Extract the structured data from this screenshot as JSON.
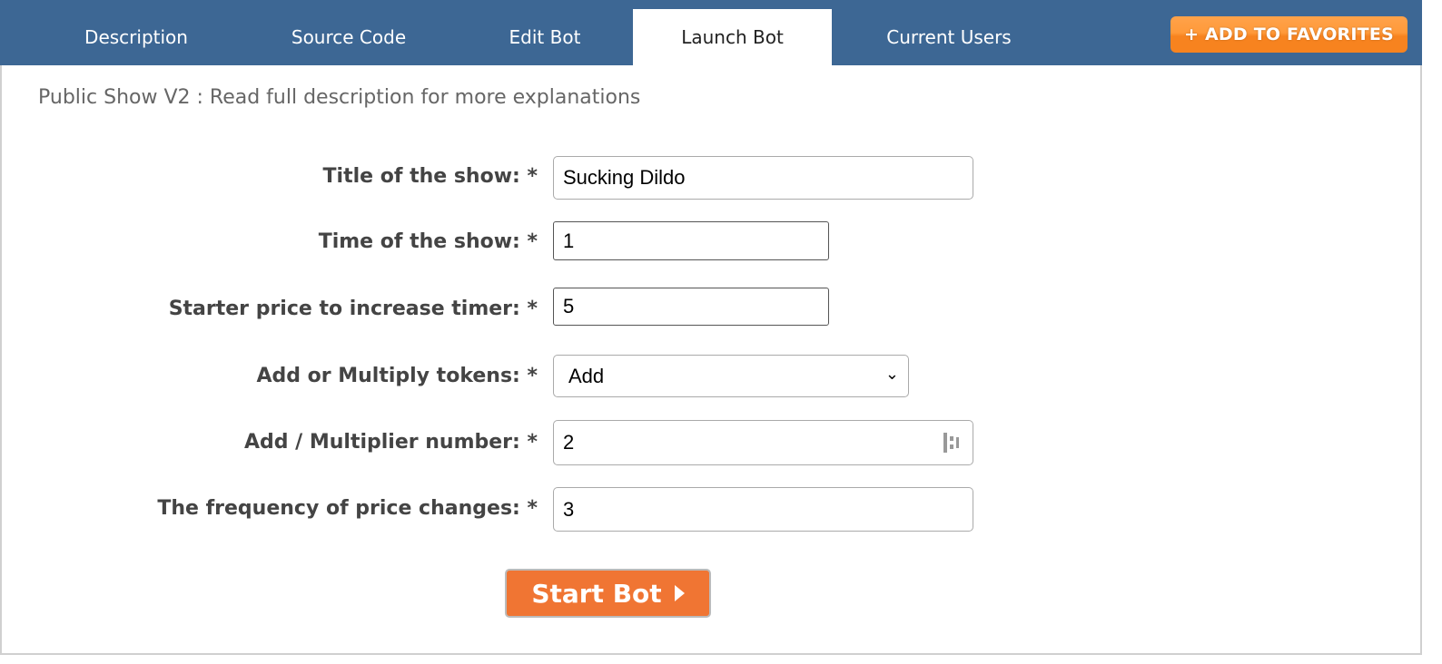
{
  "tabs": [
    {
      "label": "Description"
    },
    {
      "label": "Source Code"
    },
    {
      "label": "Edit Bot"
    },
    {
      "label": "Launch Bot",
      "active": true
    },
    {
      "label": "Current Users"
    }
  ],
  "favorites_label": "+ ADD TO FAVORITES",
  "subtitle": "Public Show V2 : Read full description for more explanations",
  "fields": [
    {
      "label": "Title of the show: *",
      "value": "Sucking Dildo"
    },
    {
      "label": "Time of the show: *",
      "value": "1"
    },
    {
      "label": "Starter price to increase timer: *",
      "value": "5"
    },
    {
      "label": "Add or Multiply tokens: *",
      "value": "Add"
    },
    {
      "label": "Add / Multiplier number: *",
      "value": "2"
    },
    {
      "label": "The frequency of price changes: *",
      "value": "3"
    }
  ],
  "start_label": "Start Bot",
  "colors": {
    "header": "#3d6794",
    "accent": "#f07533"
  }
}
